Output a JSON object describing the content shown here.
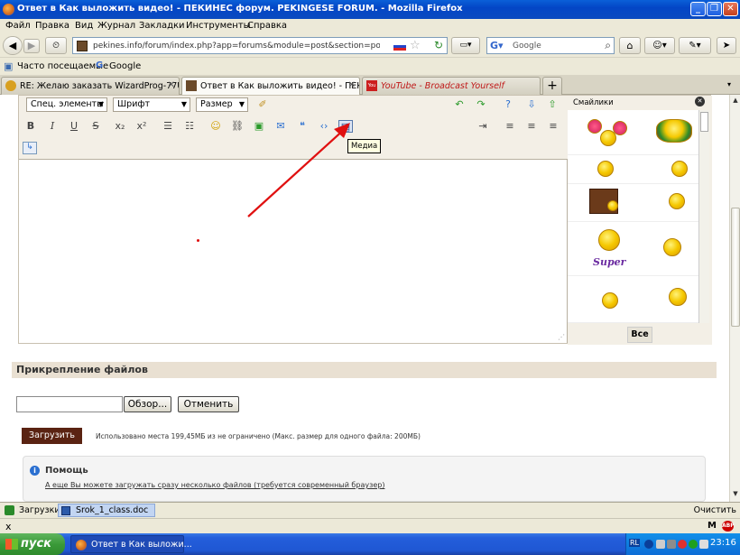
{
  "window": {
    "title": "Ответ в Как выложить видео! - ПЕКИНЕС форум. PEKINGESE FORUM. - Mozilla Firefox"
  },
  "menubar": [
    "Файл",
    "Правка",
    "Вид",
    "Журнал",
    "Закладки",
    "Инструменты",
    "Справка"
  ],
  "navbar": {
    "url": "pekines.info/forum/index.php?app=forums&module=post&section=post&do=reply_post",
    "search_placeholder": "Google"
  },
  "bookmarks": {
    "most_visited": "Часто посещаемые",
    "google": "Google"
  },
  "tabs": [
    {
      "label": "RE: Желаю заказать WizardProg-77US..."
    },
    {
      "label": "Ответ в Как выложить видео! - ПЕКИН..."
    },
    {
      "label": "YouTube - Broadcast Yourself"
    }
  ],
  "editor": {
    "special_elements": "Спец. элементы",
    "font": "Шрифт",
    "size": "Размер",
    "tooltip": "Медиа",
    "smilies_title": "Смайлики",
    "smilies_all": "Все",
    "smiley_super": "Super"
  },
  "attachments": {
    "header": "Прикрепление файлов",
    "browse_button": "Обзор...",
    "cancel_button": "Отменить",
    "upload_button": "Загрузить",
    "usage_text": "Использовано места 199,45МБ из не ограничено (Макс. размер для одного файла: 200МБ)",
    "help_title": "Помощь",
    "help_text": "А еще Вы можете загружать сразу несколько файлов (требуется современный браузер)"
  },
  "download_bar": {
    "label": "Загрузки",
    "item": "Srok_1_class.doc",
    "clear": "Очистить"
  },
  "statusbar": {
    "close": "x",
    "m": "M",
    "abp": "ABP"
  },
  "taskbar": {
    "start": "пуск",
    "item": "Ответ в Как выложи...",
    "lang": "RL",
    "time": "23:16"
  },
  "colors": {
    "titlebar": "#0346c6",
    "upload_button": "#5a2312",
    "section_header": "#e9e0d2",
    "annotation_arrow": "#e01010"
  }
}
